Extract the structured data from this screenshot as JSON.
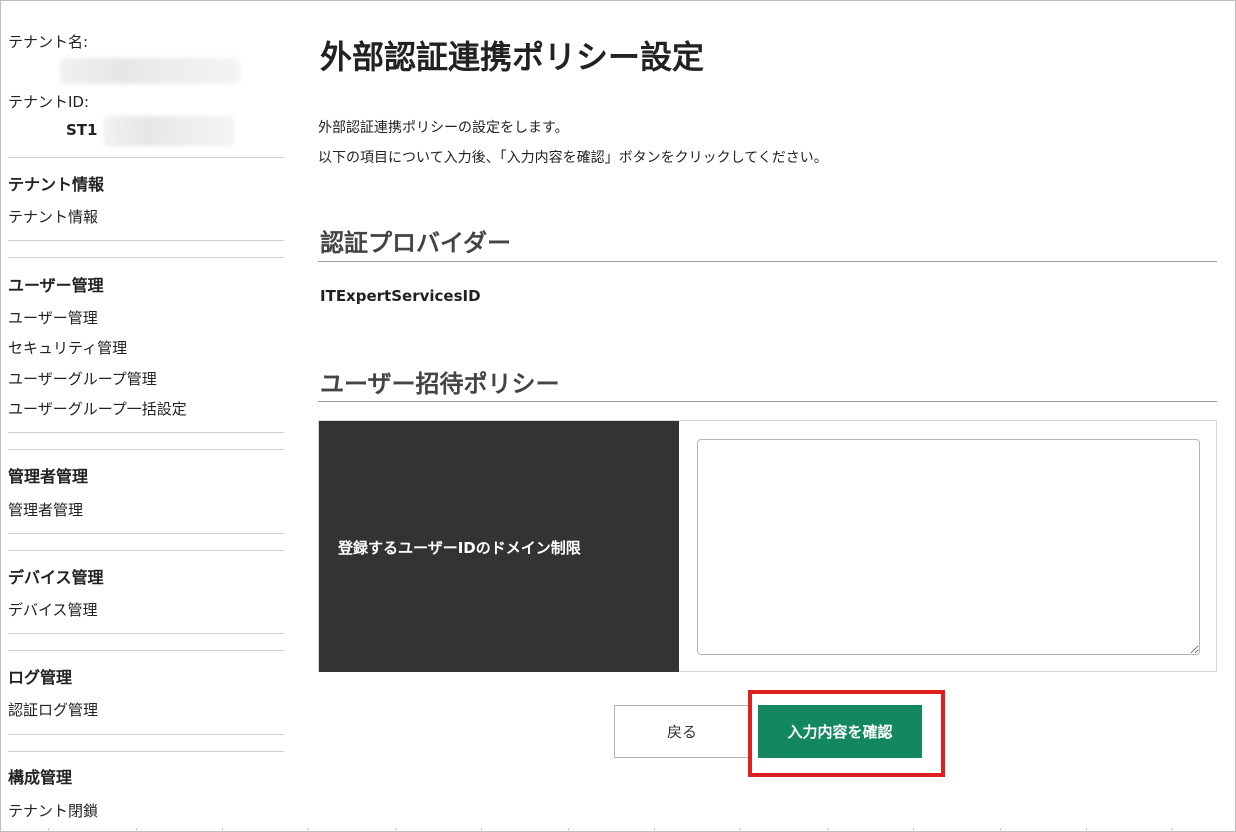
{
  "sidebar": {
    "tenant_name_label": "テナント名:",
    "tenant_id_label": "テナントID:",
    "tenant_id_prefix": "ST1",
    "groups": [
      {
        "title": "テナント情報",
        "items": [
          "テナント情報"
        ]
      },
      {
        "title": "ユーザー管理",
        "items": [
          "ユーザー管理",
          "セキュリティ管理",
          "ユーザーグループ管理",
          "ユーザーグループ一括設定"
        ]
      },
      {
        "title": "管理者管理",
        "items": [
          "管理者管理"
        ]
      },
      {
        "title": "デバイス管理",
        "items": [
          "デバイス管理"
        ]
      },
      {
        "title": "ログ管理",
        "items": [
          "認証ログ管理"
        ]
      },
      {
        "title": "構成管理",
        "items": [
          "テナント閉鎖"
        ]
      }
    ]
  },
  "main": {
    "title": "外部認証連携ポリシー設定",
    "description": [
      "外部認証連携ポリシーの設定をします。",
      "以下の項目について入力後、「入力内容を確認」ボタンをクリックしてください。"
    ],
    "provider_section": {
      "heading": "認証プロバイダー",
      "value": "ITExpertServicesID"
    },
    "invite_section": {
      "heading": "ユーザー招待ポリシー",
      "domain_restriction_label": "登録するユーザーIDのドメイン制限",
      "domain_restriction_value": ""
    },
    "buttons": {
      "back": "戻る",
      "confirm": "入力内容を確認"
    }
  }
}
